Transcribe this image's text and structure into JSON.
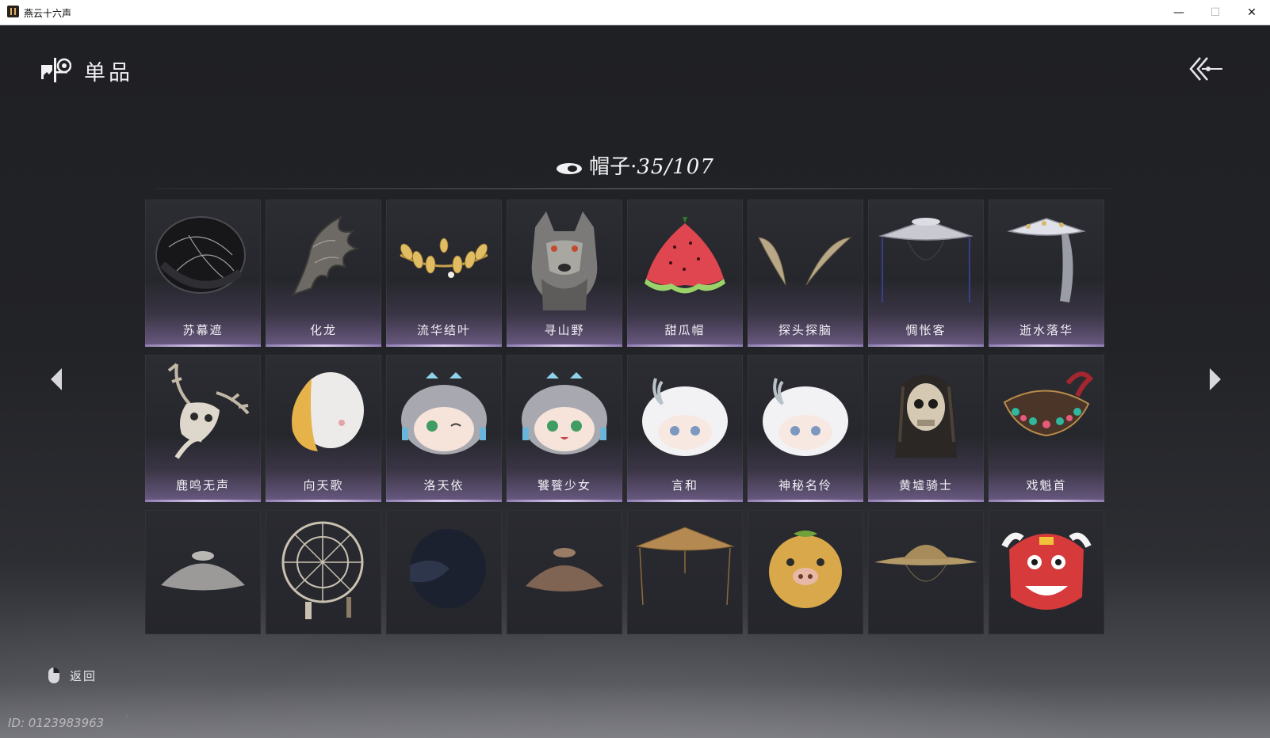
{
  "window": {
    "title": "燕云十六声",
    "minimize": "—",
    "maximize": "☐",
    "close": "✕"
  },
  "page": {
    "title": "单品",
    "category": "帽子",
    "separator": "·",
    "count": "35/107",
    "back_hint": "返回",
    "player_id": "ID: 0123983963"
  },
  "icons": {
    "page_logo": "wardrobe-icon",
    "back": "double-chevron-left-icon",
    "category": "hat-eye-icon",
    "prev": "triangle-left-icon",
    "next": "triangle-right-icon",
    "mouse": "mouse-right-click-icon"
  },
  "items": [
    {
      "name": "苏幕遮",
      "art": "dark-drum-hat"
    },
    {
      "name": "化龙",
      "art": "dragon-crest"
    },
    {
      "name": "流华结叶",
      "art": "gold-leaf-crown"
    },
    {
      "name": "寻山野",
      "art": "wolf-head"
    },
    {
      "name": "甜瓜帽",
      "art": "watermelon-hat"
    },
    {
      "name": "探头探脑",
      "art": "feather-antennae"
    },
    {
      "name": "惆怅客",
      "art": "veiled-hat"
    },
    {
      "name": "逝水落华",
      "art": "silver-veil-hat"
    },
    {
      "name": "鹿鸣无声",
      "art": "deer-skull"
    },
    {
      "name": "向天歌",
      "art": "goose-hood"
    },
    {
      "name": "洛天依",
      "art": "chibi-grey-wink"
    },
    {
      "name": "饕餮少女",
      "art": "chibi-grey-smile"
    },
    {
      "name": "言和",
      "art": "chibi-white"
    },
    {
      "name": "神秘名伶",
      "art": "chibi-white-2"
    },
    {
      "name": "黄墟骑士",
      "art": "skull-dreadlocks"
    },
    {
      "name": "戏魁首",
      "art": "opera-headdress"
    },
    {
      "name": "",
      "art": "grey-bowl-hat"
    },
    {
      "name": "",
      "art": "bamboo-frame-hat"
    },
    {
      "name": "",
      "art": "dark-cloth-hat"
    },
    {
      "name": "",
      "art": "clay-bowl-hat"
    },
    {
      "name": "",
      "art": "straw-bead-hat"
    },
    {
      "name": "",
      "art": "gold-pig-mask"
    },
    {
      "name": "",
      "art": "straw-conical-hat"
    },
    {
      "name": "",
      "art": "lion-dance-head"
    }
  ],
  "colors": {
    "accent": "#b7a6d8",
    "text": "#f2f0f6",
    "background": "#1f2024"
  }
}
